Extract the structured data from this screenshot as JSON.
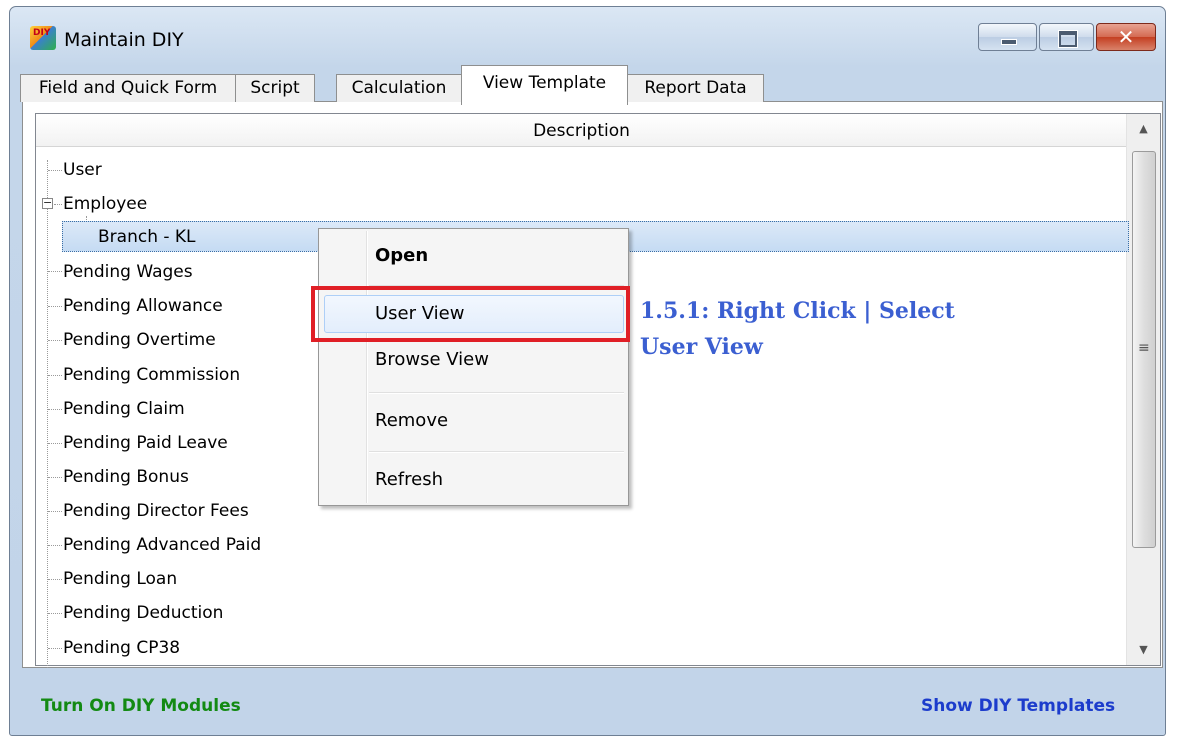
{
  "window": {
    "title": "Maintain DIY",
    "app_icon_text": "DIY",
    "close_symbol": "✕"
  },
  "tabs": [
    {
      "label": "Field and Quick Form",
      "active": false
    },
    {
      "label": "Script",
      "active": false
    },
    {
      "label": "Calculation",
      "active": false
    },
    {
      "label": "View Template",
      "active": true
    },
    {
      "label": "Report Data",
      "active": false
    }
  ],
  "tree": {
    "column_header": "Description",
    "expander_symbol": "−",
    "scroll_up_symbol": "▲",
    "scroll_down_symbol": "▼",
    "grip_symbol": "≡",
    "items": [
      {
        "label": "User",
        "level": 0
      },
      {
        "label": "Employee",
        "level": 0,
        "expanded": true
      },
      {
        "label": "Branch - KL",
        "level": 1,
        "selected": true
      },
      {
        "label": "Pending Wages",
        "level": 0
      },
      {
        "label": "Pending Allowance",
        "level": 0
      },
      {
        "label": "Pending Overtime",
        "level": 0
      },
      {
        "label": "Pending Commission",
        "level": 0
      },
      {
        "label": "Pending Claim",
        "level": 0
      },
      {
        "label": "Pending Paid Leave",
        "level": 0
      },
      {
        "label": "Pending Bonus",
        "level": 0
      },
      {
        "label": "Pending Director Fees",
        "level": 0
      },
      {
        "label": "Pending Advanced Paid",
        "level": 0
      },
      {
        "label": "Pending Loan",
        "level": 0
      },
      {
        "label": "Pending Deduction",
        "level": 0
      },
      {
        "label": "Pending CP38",
        "level": 0
      }
    ]
  },
  "context_menu": {
    "items": [
      {
        "label": "Open",
        "bold": true
      },
      {
        "label": "User View",
        "hovered": true
      },
      {
        "label": "Browse View"
      },
      {
        "label": "Remove"
      },
      {
        "label": "Refresh"
      }
    ]
  },
  "annotation": {
    "line1": "1.5.1: Right Click | Select",
    "line2": "User View",
    "color": "#3b5fd1",
    "highlight_color": "#e01f26"
  },
  "footer": {
    "left_link": "Turn On DIY Modules",
    "right_link": "Show DIY Templates",
    "left_color": "#138a13",
    "right_color": "#1c3ccc"
  }
}
